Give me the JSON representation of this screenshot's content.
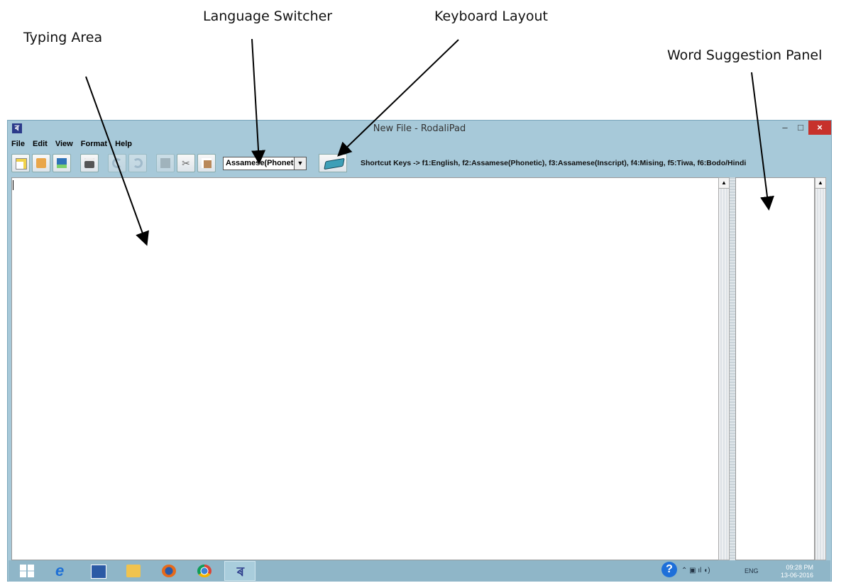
{
  "annotations": {
    "typing_area": "Typing Area",
    "language_switcher": "Language Switcher",
    "keyboard_layout": "Keyboard Layout",
    "word_suggestion_panel": "Word Suggestion Panel"
  },
  "window": {
    "title": "New File - RodaliPad",
    "app_icon": "ৰ",
    "minimize": "–",
    "maximize": "□",
    "close": "×"
  },
  "menu": [
    "File",
    "Edit",
    "View",
    "Format",
    "Help"
  ],
  "toolbar": {
    "buttons": [
      "new-file-icon",
      "open-file-icon",
      "save-icon",
      "print-icon",
      "undo-icon",
      "redo-icon",
      "copy-icon",
      "cut-icon",
      "paste-icon",
      "keyboard-icon"
    ],
    "language_selected": "Assamese(Phonetic)",
    "dropdown_arrow": "▼",
    "shortcut_text": "Shortcut Keys -> f1:English, f2:Assamese(Phonetic), f3:Assamese(Inscript), f4:Mising, f5:Tiwa, f6:Bodo/Hindi"
  },
  "editor": {
    "text": "",
    "suggestions": []
  },
  "scroll": {
    "up_arrow": "▲"
  },
  "taskbar": {
    "apps": [
      "windows-start-icon",
      "internet-explorer-icon",
      "word-icon",
      "file-explorer-icon",
      "firefox-icon",
      "chrome-icon",
      "rodalipad-icon"
    ],
    "help": "?",
    "tray_symbols": "⌃  ▣ ıl ◖)",
    "language": "ENG",
    "time": "09:28 PM",
    "date": "13-06-2016"
  },
  "colors": {
    "window_frame": "#a7c9d9",
    "close_button": "#c7312b",
    "taskbar": "#8fb6c8",
    "keyboard_icon": "#3e9fb7"
  }
}
